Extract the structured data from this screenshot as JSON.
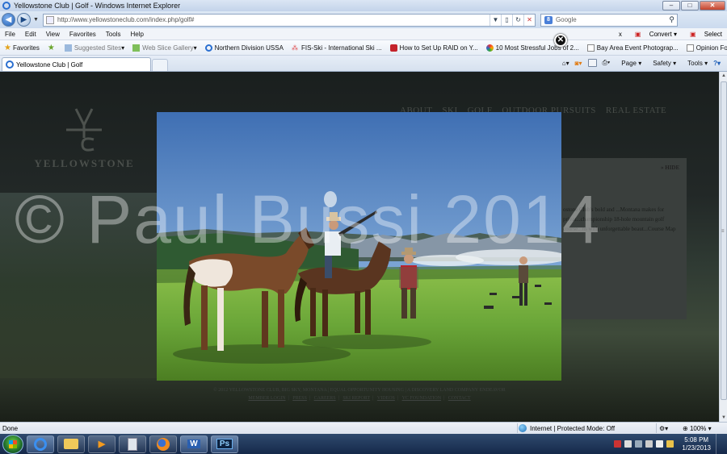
{
  "window": {
    "title": "Yellowstone Club | Golf - Windows Internet Explorer",
    "controls": [
      "–",
      "□",
      "✕"
    ]
  },
  "address_bar": {
    "url": "http://www.yellowstoneclub.com/index.php/golf#",
    "search_placeholder": "Google"
  },
  "menu": {
    "items": [
      "File",
      "Edit",
      "View",
      "Favorites",
      "Tools",
      "Help"
    ],
    "right": {
      "close": "x",
      "convert": "Convert",
      "select": "Select"
    }
  },
  "favorites_bar": {
    "label": "Favorites",
    "items": [
      "Suggested Sites",
      "Web Slice Gallery",
      "Northern Division USSA",
      "FIS-Ski - International Ski ...",
      "How to Set Up RAID on Y...",
      "10 Most Stressful Jobs of 2...",
      "Bay Area Event Photograp...",
      "Opinion Forum » Ski Raci..."
    ]
  },
  "tab": {
    "label": "Yellowstone Club | Golf"
  },
  "command_bar": {
    "page": "Page",
    "safety": "Safety",
    "tools": "Tools"
  },
  "site": {
    "logo_text": "YELLOWSTONE",
    "nav": [
      "ABOUT",
      "SKI",
      "GOLF",
      "OUTDOOR PURSUITS",
      "REAL ESTATE"
    ],
    "hide_label": "» HIDE",
    "bg_text": "ostone Club's bold and ...Montana makes for privat...championship 18-hole mountain golf course...ns with unforgettable beaut...Course Map",
    "footer_line": "© 2012 YELLOWSTONE CLUB, BIG SKY, MONTANA | EQUAL OPPORTUNITY HOUSING | A DISCOVERY LAND COMPANY ENDEAVOR",
    "footer_links": [
      "MEMBER LOGIN",
      "PRESS",
      "CAREERS",
      "SKI REPORT",
      "VIDEOS",
      "YC FOUNDATION",
      "CONTACT"
    ]
  },
  "watermark": "© Paul Bussi 2014",
  "lightbox": {
    "close_glyph": "✕"
  },
  "status_bar": {
    "left": "Done",
    "zone": "Internet | Protected Mode: Off",
    "zoom": "100%"
  },
  "taskbar": {
    "clock_time": "5:08 PM",
    "clock_date": "1/23/2013",
    "pinned": [
      "internet-explorer",
      "windows-explorer",
      "media-player",
      "calculator",
      "firefox",
      "word",
      "photoshop"
    ],
    "photoshop_label": "Ps"
  },
  "colors": {
    "accent": "#2a6fd0",
    "sky": "#5a8ac7",
    "grass": "#6aa638"
  }
}
